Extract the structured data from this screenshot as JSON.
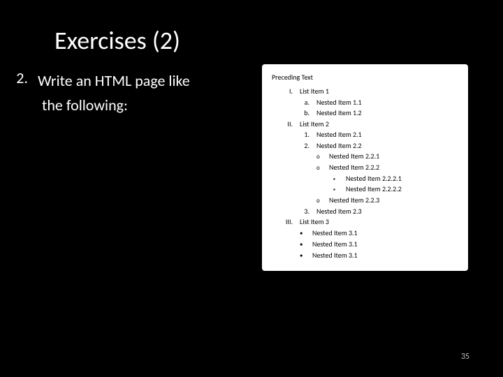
{
  "title": "Exercises (2)",
  "exercise": {
    "number": "2.",
    "line1": "Write an HTML page like",
    "line2": "the following:"
  },
  "doc": {
    "heading": "Preceding Text",
    "items": {
      "li1_marker": "I.",
      "li1_text": "List Item 1",
      "li1_a_marker": "a.",
      "li1_a_text": "Nested Item 1.1",
      "li1_b_marker": "b.",
      "li1_b_text": "Nested Item 1.2",
      "li2_marker": "II.",
      "li2_text": "List Item 2",
      "li2_1_marker": "1.",
      "li2_1_text": "Nested Item 2.1",
      "li2_2_marker": "2.",
      "li2_2_text": "Nested Item 2.2",
      "li2_2_1_marker": "o",
      "li2_2_1_text": "Nested Item 2.2.1",
      "li2_2_2_marker": "o",
      "li2_2_2_text": "Nested Item 2.2.2",
      "li2_2_2_1_marker": "▪",
      "li2_2_2_1_text": "Nested Item 2.2.2.1",
      "li2_2_2_2_marker": "▪",
      "li2_2_2_2_text": "Nested Item 2.2.2.2",
      "li2_2_3_marker": "o",
      "li2_2_3_text": "Nested Item 2.2.3",
      "li2_3_marker": "3.",
      "li2_3_text": "Nested Item 2.3",
      "li3_marker": "III.",
      "li3_text": "List Item 3",
      "li3_1_marker": "•",
      "li3_1_text": "Nested Item 3.1",
      "li3_2_marker": "•",
      "li3_2_text": "Nested Item 3.1",
      "li3_3_marker": "•",
      "li3_3_text": "Nested Item 3.1"
    }
  },
  "page_number": "35"
}
